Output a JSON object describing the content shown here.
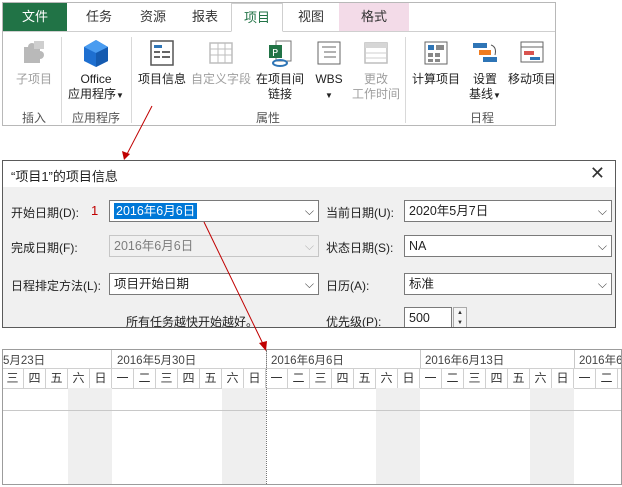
{
  "ribbon": {
    "tabs": [
      {
        "label": "文件"
      },
      {
        "label": "任务"
      },
      {
        "label": "资源"
      },
      {
        "label": "报表"
      },
      {
        "label": "项目"
      },
      {
        "label": "视图"
      },
      {
        "label": "格式"
      }
    ],
    "buttons": {
      "subproject": "子项目",
      "office_apps_line1": "Office",
      "office_apps_line2": "应用程序",
      "project_info": "项目信息",
      "custom_fields": "自定义字段",
      "links_line1": "在项目间",
      "links_line2": "链接",
      "wbs": "WBS",
      "change_time_line1": "更改",
      "change_time_line2": "工作时间",
      "calc_project": "计算项目",
      "set_baseline_line1": "设置",
      "set_baseline_line2": "基线",
      "move_project": "移动项目"
    },
    "groups": {
      "insert": "插入",
      "apps": "应用程序",
      "properties": "属性",
      "schedule": "日程"
    }
  },
  "dialog": {
    "title": "“项目1”的项目信息",
    "start_date_label": "开始日期(D):",
    "start_date_value": "2016年6月6日",
    "marker": "1",
    "finish_date_label": "完成日期(F):",
    "finish_date_value": "2016年6月6日",
    "schedule_from_label": "日程排定方法(L):",
    "schedule_from_value": "项目开始日期",
    "schedule_note": "所有任务越快开始越好。",
    "current_date_label": "当前日期(U):",
    "current_date_value": "2020年5月7日",
    "status_date_label": "状态日期(S):",
    "status_date_value": "NA",
    "calendar_label": "日历(A):",
    "calendar_value": "标准",
    "priority_label": "优先级(P):",
    "priority_value": "500"
  },
  "timescale": {
    "weeks": [
      "5月23日",
      "2016年5月30日",
      "2016年6月6日",
      "2016年6月13日",
      "2016年6"
    ],
    "days": [
      "三",
      "四",
      "五",
      "六",
      "日",
      "一",
      "二",
      "三",
      "四",
      "五",
      "六",
      "日",
      "一",
      "二",
      "三",
      "四",
      "五",
      "六",
      "日",
      "一",
      "二",
      "三",
      "四",
      "五",
      "六",
      "日",
      "一",
      "二"
    ]
  },
  "colors": {
    "file_tab": "#217346",
    "selection": "#0078d7",
    "arrow": "#c00000",
    "format_tab": "#f3dbe8"
  }
}
